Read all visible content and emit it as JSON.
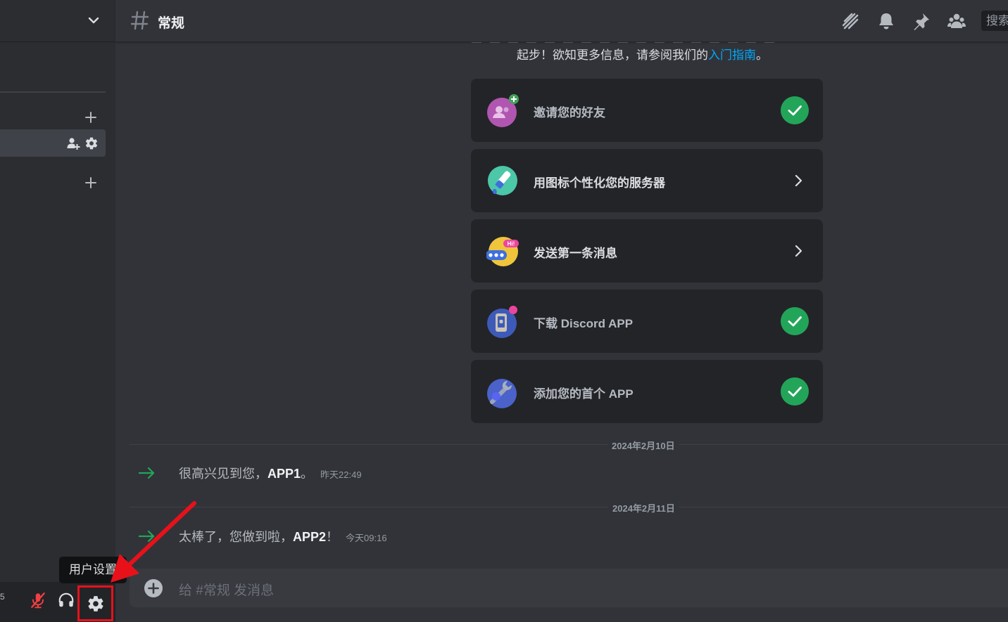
{
  "channel": {
    "title": "常规"
  },
  "toolbar": {
    "icons": [
      "threads-icon",
      "bell-icon",
      "pin-icon",
      "members-icon"
    ],
    "search_placeholder": "搜索"
  },
  "sidebar": {
    "user_panel": {
      "edge_text": "5"
    },
    "tooltip": "用户设置"
  },
  "intro": {
    "text": "起步！欲知更多信息，请参阅我们的",
    "link": "入门指南",
    "tail": "。"
  },
  "checklist": [
    {
      "label": "邀请您的好友",
      "done": true,
      "icon": "invite-friends-icon"
    },
    {
      "label": "用图标个性化您的服务器",
      "done": false,
      "icon": "paintbrush-icon"
    },
    {
      "label": "发送第一条消息",
      "done": false,
      "icon": "chat-bubble-icon"
    },
    {
      "label": "下载 Discord APP",
      "done": true,
      "icon": "phone-app-icon"
    },
    {
      "label": "添加您的首个 APP",
      "done": true,
      "icon": "wrench-icon"
    }
  ],
  "messages": [
    {
      "date": "2024年2月10日",
      "before": "很高兴见到您，",
      "user": "APP1",
      "after": "。",
      "time": "昨天22:49"
    },
    {
      "date": "2024年2月11日",
      "before": "太棒了，您做到啦，",
      "user": "APP2",
      "after": "！",
      "time": "今天09:16"
    }
  ],
  "composer": {
    "placeholder": "给 #常规 发消息"
  },
  "colors": {
    "accent_link": "#00a8fc",
    "success": "#23a559",
    "annotation": "#e8111a",
    "mute_red": "#f23f43"
  }
}
